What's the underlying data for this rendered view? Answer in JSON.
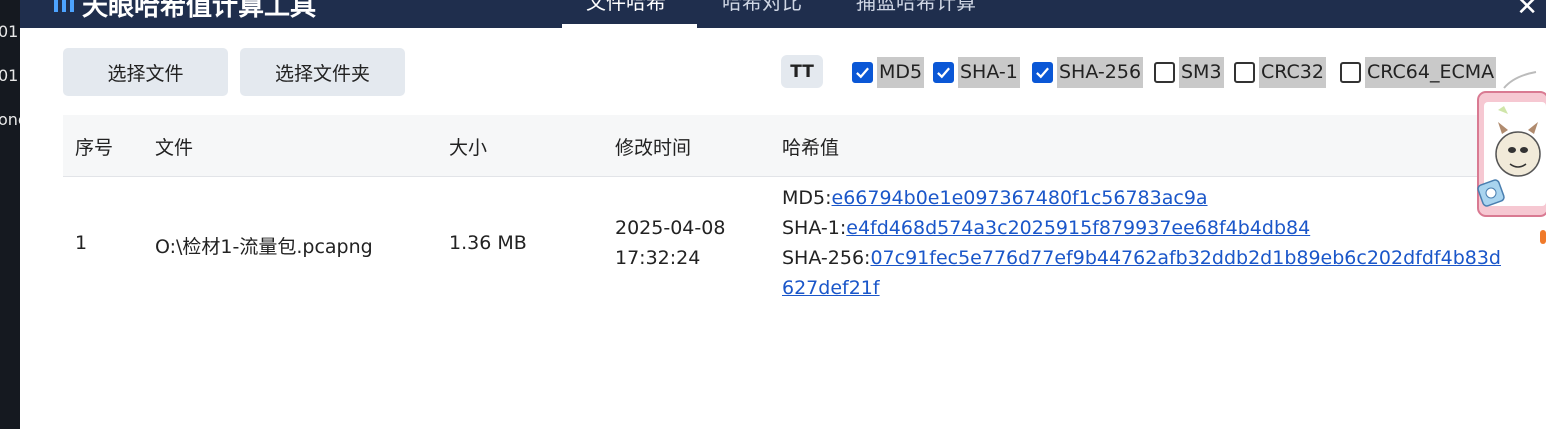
{
  "background_app": {
    "fragments": [
      "01",
      "01",
      "one"
    ]
  },
  "header": {
    "title": "天眼哈希值计算工具",
    "tabs": [
      {
        "label": "文件哈希",
        "active": true
      },
      {
        "label": "哈希对比",
        "active": false
      },
      {
        "label": "捕蓝哈希计算",
        "active": false
      }
    ],
    "close_label": "✕"
  },
  "toolbar": {
    "select_file_label": "选择文件",
    "select_folder_label": "选择文件夹",
    "font_toggle_label": "TT",
    "algorithms": [
      {
        "label": "MD5",
        "checked": true
      },
      {
        "label": "SHA-1",
        "checked": true
      },
      {
        "label": "SHA-256",
        "checked": true
      },
      {
        "label": "SM3",
        "checked": false
      },
      {
        "label": "CRC32",
        "checked": false
      },
      {
        "label": "CRC64_ECMA",
        "checked": false
      }
    ]
  },
  "table": {
    "columns": [
      "序号",
      "文件",
      "大小",
      "修改时间",
      "哈希值"
    ],
    "rows": [
      {
        "index": "1",
        "file": "O:\\检材1-流量包.pcapng",
        "size": "1.36 MB",
        "modified_date": "2025-04-08",
        "modified_time": "17:32:24",
        "hashes": {
          "md5_label": "MD5:",
          "md5": "e66794b0e1e097367480f1c56783ac9a",
          "sha1_label": "SHA-1:",
          "sha1": "e4fd468d574a3c2025915f879937ee68f4b4db84",
          "sha256_label": "SHA-256:",
          "sha256_part1": "07c91fec5e776d77ef9b44762afb32ddb2d1b89eb6c202dfdf4b83d",
          "sha256_part2": "627def21f"
        }
      }
    ]
  },
  "colors": {
    "header_bg": "#1f2e4d",
    "checkbox_checked": "#0a57d6",
    "link": "#1a56c9",
    "button_bg": "#e4e9ef"
  }
}
